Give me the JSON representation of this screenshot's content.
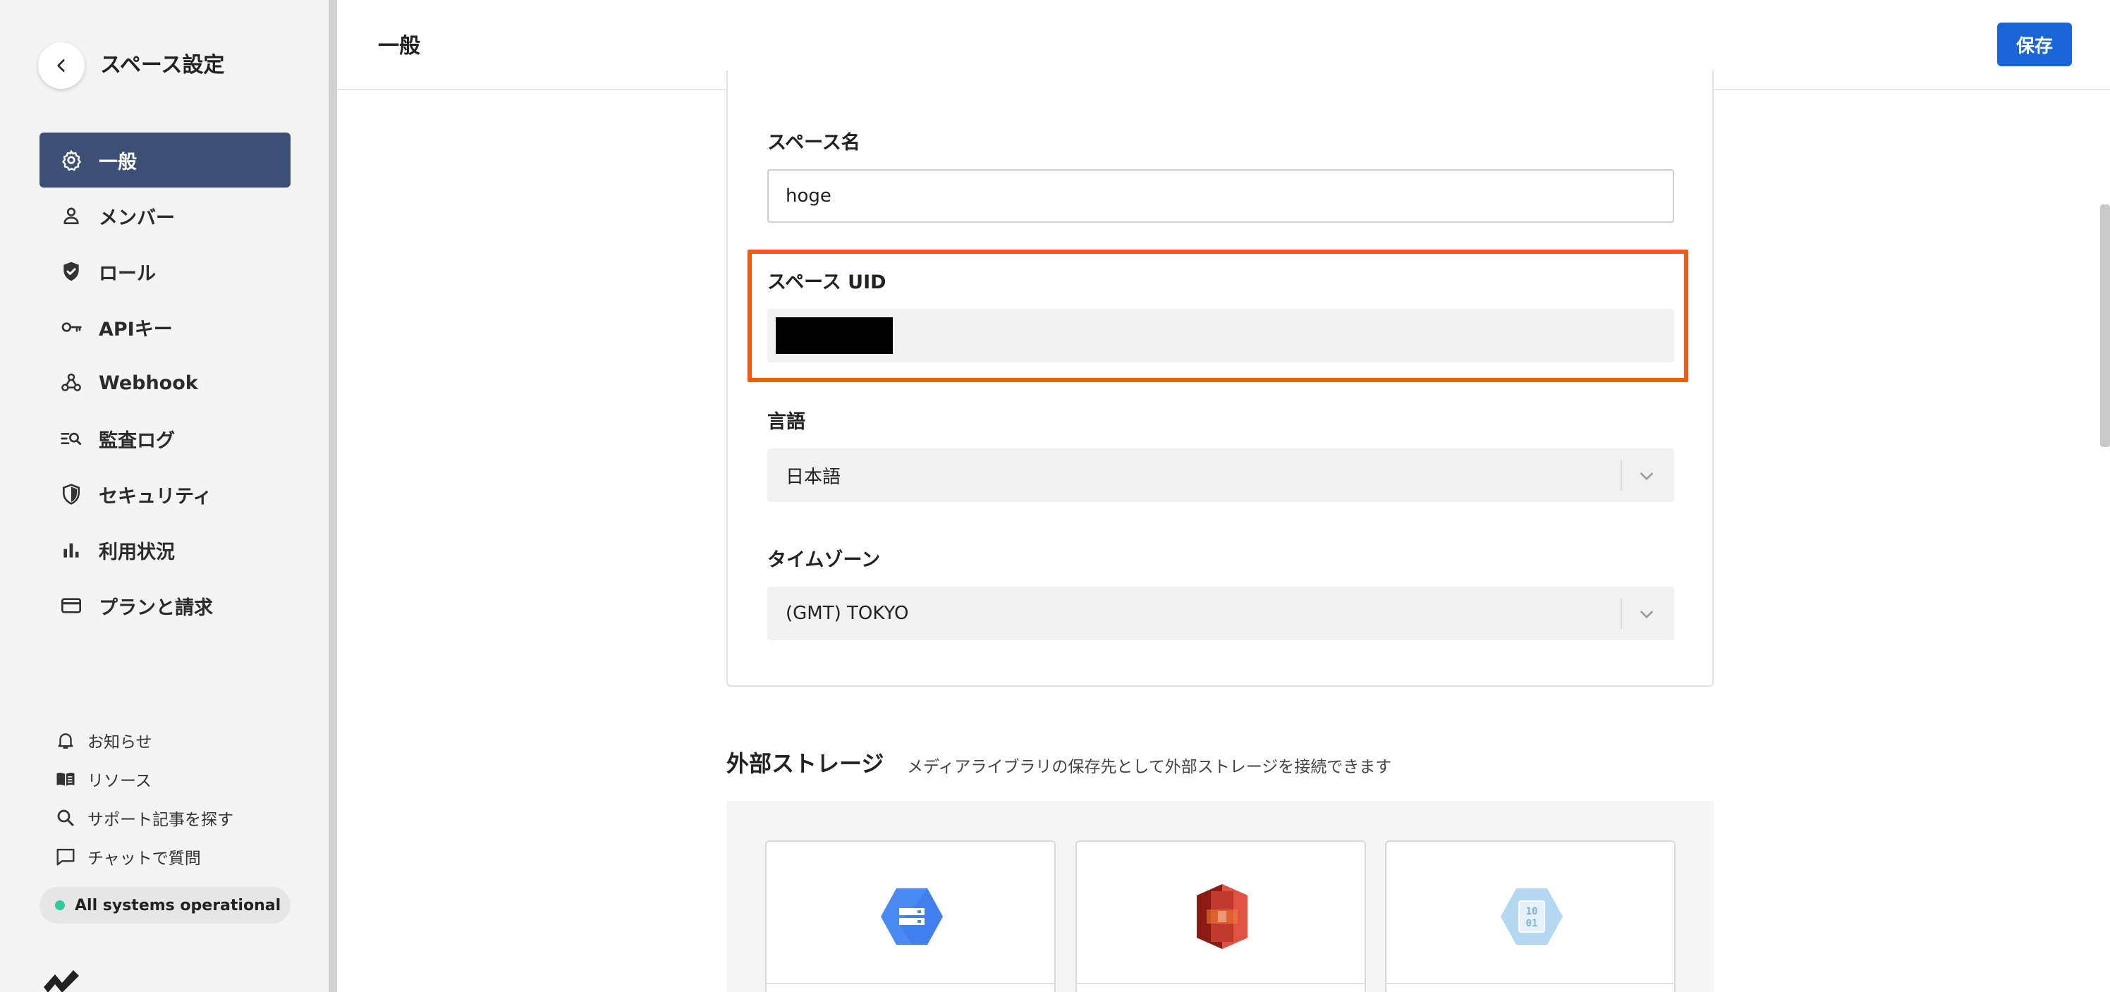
{
  "sidebar": {
    "title": "スペース設定",
    "nav_items": [
      {
        "label": "一般",
        "icon": "gear-icon",
        "active": true
      },
      {
        "label": "メンバー",
        "icon": "person-icon"
      },
      {
        "label": "ロール",
        "icon": "shield-check-icon"
      },
      {
        "label": "APIキー",
        "icon": "key-icon"
      },
      {
        "label": "Webhook",
        "icon": "webhook-icon"
      },
      {
        "label": "監査ログ",
        "icon": "list-search-icon"
      },
      {
        "label": "セキュリティ",
        "icon": "shield-icon"
      },
      {
        "label": "利用状況",
        "icon": "bar-chart-icon"
      },
      {
        "label": "プランと請求",
        "icon": "credit-card-icon"
      }
    ],
    "footer_links": [
      {
        "label": "お知らせ",
        "icon": "bell-icon"
      },
      {
        "label": "リソース",
        "icon": "book-icon"
      },
      {
        "label": "サポート記事を探す",
        "icon": "search-icon"
      },
      {
        "label": "チャットで質問",
        "icon": "chat-icon"
      }
    ],
    "status": {
      "label": "All systems operational",
      "color": "#31c9a0"
    }
  },
  "header": {
    "title": "一般",
    "save_label": "保存"
  },
  "form": {
    "space_name": {
      "label": "スペース名",
      "value": "hoge"
    },
    "space_uid": {
      "label": "スペース UID"
    },
    "language": {
      "label": "言語",
      "value": "日本語"
    },
    "timezone": {
      "label": "タイムゾーン",
      "value": "(GMT) TOKYO"
    }
  },
  "external_storage": {
    "title": "外部ストレージ",
    "description": "メディアライブラリの保存先として外部ストレージを接続できます",
    "providers": [
      {
        "icon": "google-cloud-storage-icon"
      },
      {
        "icon": "amazon-s3-icon"
      },
      {
        "icon": "azure-blob-storage-icon"
      }
    ]
  },
  "colors": {
    "accent": "#1a66d8",
    "nav_active": "#3c5075",
    "highlight": "#f15a12"
  }
}
